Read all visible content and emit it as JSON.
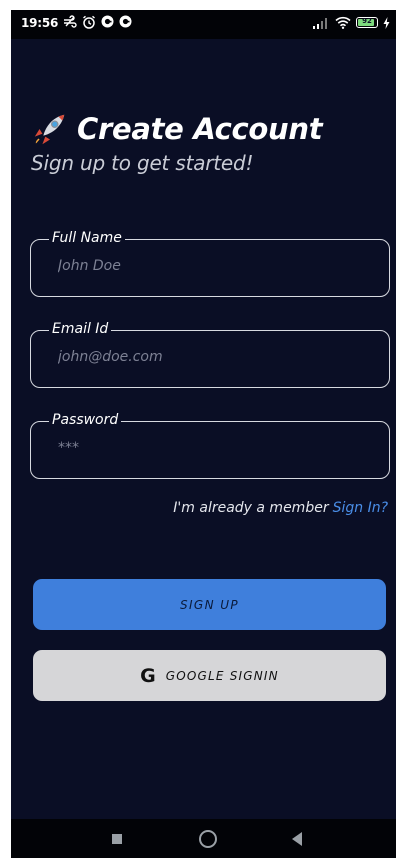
{
  "status_bar": {
    "time": "19:56",
    "battery_level": "92",
    "icons": [
      "alarm-icon",
      "notification-icon",
      "signal-icon",
      "wifi-icon",
      "battery-icon",
      "charging-icon"
    ]
  },
  "header": {
    "title": "Create Account",
    "subtitle": "Sign up to get started!",
    "icon": "rocket-icon"
  },
  "form": {
    "full_name": {
      "label": "Full Name",
      "placeholder": "John Doe",
      "value": ""
    },
    "email": {
      "label": "Email Id",
      "placeholder": "john@doe.com",
      "value": ""
    },
    "password": {
      "label": "Password",
      "placeholder": "***",
      "value": ""
    }
  },
  "member": {
    "text": "I'm already a member",
    "link": "Sign In?"
  },
  "buttons": {
    "signup": "SIGN UP",
    "google": "GOOGLE SIGNIN",
    "google_icon": "G"
  },
  "colors": {
    "background": "#0a0e25",
    "accent": "#3f7fdc",
    "link": "#4a8ee8",
    "google_button": "#d6d6d8"
  }
}
